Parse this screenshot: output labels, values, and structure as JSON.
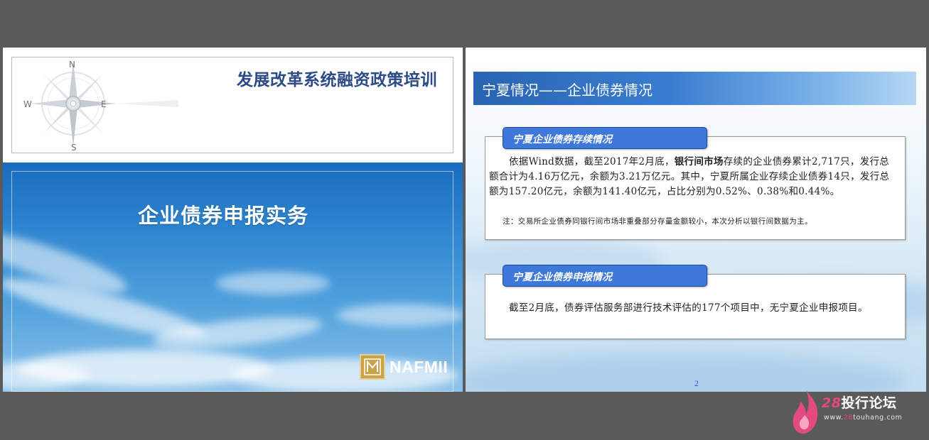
{
  "slide1": {
    "title": "发展改革系统融资政策培训",
    "subtitle": "企业债券申报实务",
    "compass_letters": {
      "n": "N",
      "w": "W",
      "e": "E",
      "s": "S"
    },
    "logo_text": "NAFMII"
  },
  "slide2": {
    "banner_title": "宁夏情况——企业债券情况",
    "section1": {
      "tab_label": "宁夏企业债券存续情况",
      "para_before_bold": "依据Wind数据，截至2017年2月底，",
      "para_bold": "银行间市场",
      "para_after_bold": "存续的企业债券累计2,717只，发行总额合计为4.16万亿元，余额为3.21万亿元。其中，宁夏所属企业存续企业债券14只，发行总额为157.20亿元，余额为141.40亿元，占比分别为0.52%、0.38%和0.44%。",
      "note": "注：交易所企业债券同银行间市场非重叠部分存量金额较小，本次分析以银行间数据为主。"
    },
    "section2": {
      "tab_label": "宁夏企业债券申报情况",
      "paragraph": "截至2月底，债券评估服务部进行技术评估的177个项目中，无宁夏企业申报项目。"
    },
    "page_number": "2"
  },
  "watermark": {
    "number": "28",
    "name": "投行论坛",
    "url_prefix": "www.",
    "url_highlight": "28",
    "url_suffix": "touhang.com"
  },
  "colors": {
    "viewer_bg": "#5a5a5a",
    "title_blue": "#2b4a86",
    "tab_blue": "#3e78d9",
    "banner_blue": "#2a63b3",
    "watermark_pink": "#e34a7f"
  }
}
